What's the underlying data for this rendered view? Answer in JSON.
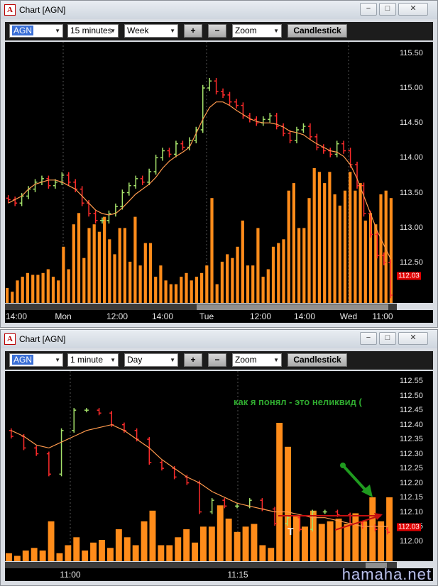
{
  "windows": [
    {
      "title": "Chart [AGN]",
      "toolbar": {
        "symbol": "AGN",
        "interval": "15 minutes",
        "range": "Week",
        "plus": "+",
        "minus": "−",
        "zoom": "Zoom",
        "style": "Candlestick"
      },
      "price_label": "112.03",
      "chart_data": {
        "type": "candlestick",
        "ylim": [
          112.0,
          115.6
        ],
        "yticks": [
          "115.50",
          "115.00",
          "114.50",
          "114.00",
          "113.50",
          "113.00",
          "112.50"
        ],
        "xticks": [
          "14:00",
          "Mon",
          "12:00",
          "14:00",
          "Tue",
          "12:00",
          "14:00",
          "Wed",
          "11:00"
        ],
        "closes": [
          113.4,
          113.35,
          113.45,
          113.55,
          113.65,
          113.7,
          113.6,
          113.65,
          113.75,
          113.65,
          113.55,
          113.35,
          113.2,
          113.1,
          113.1,
          113.2,
          113.3,
          113.5,
          113.6,
          113.7,
          113.65,
          113.8,
          114.0,
          114.1,
          114.05,
          114.2,
          114.15,
          114.25,
          114.4,
          115.0,
          115.1,
          114.95,
          114.9,
          114.8,
          114.75,
          114.6,
          114.55,
          114.5,
          114.55,
          114.6,
          114.45,
          114.35,
          114.25,
          114.4,
          114.45,
          114.3,
          114.15,
          114.1,
          114.05,
          114.2,
          114.1,
          113.9,
          113.6,
          113.2,
          112.9,
          112.6,
          112.5,
          112.03
        ],
        "ma": [
          113.35,
          113.4,
          113.45,
          113.55,
          113.62,
          113.65,
          113.68,
          113.68,
          113.65,
          113.6,
          113.55,
          113.45,
          113.35,
          113.25,
          113.2,
          113.18,
          113.2,
          113.28,
          113.38,
          113.48,
          113.55,
          113.62,
          113.72,
          113.85,
          113.95,
          114.02,
          114.08,
          114.15,
          114.35,
          114.55,
          114.72,
          114.8,
          114.8,
          114.75,
          114.68,
          114.62,
          114.56,
          114.52,
          114.5,
          114.5,
          114.48,
          114.44,
          114.38,
          114.36,
          114.33,
          114.26,
          114.2,
          114.15,
          114.1,
          114.08,
          114.02,
          113.9,
          113.7,
          113.45,
          113.2,
          112.95,
          112.75,
          112.55
        ],
        "volume": [
          8,
          6,
          12,
          14,
          16,
          15,
          15,
          16,
          18,
          14,
          12,
          30,
          18,
          42,
          48,
          24,
          40,
          42,
          38,
          46,
          34,
          26,
          40,
          40,
          22,
          46,
          20,
          32,
          32,
          14,
          20,
          12,
          10,
          10,
          14,
          16,
          12,
          14,
          16,
          20,
          56,
          10,
          22,
          26,
          24,
          30,
          44,
          20,
          20,
          40,
          14,
          18,
          30,
          32,
          34,
          60,
          64,
          40,
          40,
          56,
          72,
          70,
          64,
          70,
          58,
          52,
          60,
          70,
          60,
          64,
          44,
          48,
          42,
          58,
          60,
          56
        ]
      }
    },
    {
      "title": "Chart [AGN]",
      "toolbar": {
        "symbol": "AGN",
        "interval": "1 minute",
        "range": "Day",
        "plus": "+",
        "minus": "−",
        "zoom": "Zoom",
        "style": "Candlestick"
      },
      "price_label": "112.03",
      "annotation": "как я понял - это неликвид (",
      "marker": "T",
      "watermark": "hamaha.net",
      "chart_data": {
        "type": "candlestick",
        "ylim": [
          111.95,
          112.57
        ],
        "yticks": [
          "112.55",
          "112.50",
          "112.45",
          "112.40",
          "112.35",
          "112.30",
          "112.25",
          "112.20",
          "112.15",
          "112.10",
          "112.05",
          "112.00"
        ],
        "xticks": [
          "11:00",
          "11:15"
        ],
        "closes": [
          112.36,
          112.32,
          112.3,
          112.23,
          112.38,
          112.45,
          112.45,
          112.44,
          112.4,
          112.38,
          112.35,
          112.27,
          112.25,
          112.22,
          112.2,
          112.1,
          112.14,
          112.12,
          112.12,
          112.14,
          112.11,
          112.06,
          112.08,
          112.04,
          112.1,
          112.1,
          112.09,
          112.06,
          112.05,
          112.04,
          112.03
        ],
        "ma": [
          112.38,
          112.36,
          112.33,
          112.32,
          112.34,
          112.36,
          112.38,
          112.39,
          112.4,
          112.38,
          112.35,
          112.32,
          112.28,
          112.25,
          112.22,
          112.2,
          112.17,
          112.15,
          112.13,
          112.12,
          112.11,
          112.1,
          112.1,
          112.09,
          112.08,
          112.08,
          112.07,
          112.06,
          112.05,
          112.05,
          112.05
        ],
        "volume": [
          6,
          4,
          8,
          10,
          8,
          30,
          6,
          12,
          18,
          8,
          14,
          16,
          10,
          24,
          18,
          12,
          30,
          38,
          12,
          12,
          18,
          24,
          14,
          26,
          26,
          42,
          32,
          22,
          26,
          28,
          12,
          10,
          104,
          86,
          34,
          26,
          38,
          28,
          30,
          32,
          28,
          36,
          30,
          48,
          30,
          48
        ]
      }
    }
  ]
}
